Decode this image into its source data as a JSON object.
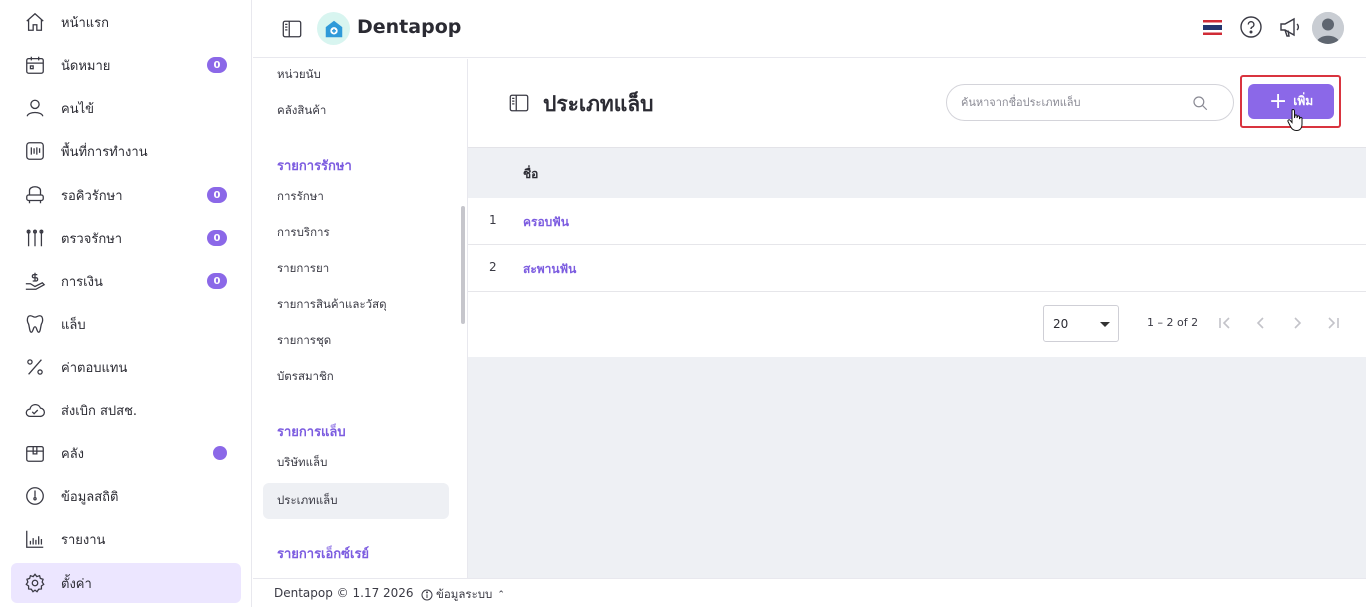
{
  "app": {
    "title": "Dentapop"
  },
  "sidebar": {
    "items": [
      {
        "label": "หน้าแรก",
        "icon": "home-icon"
      },
      {
        "label": "นัดหมาย",
        "icon": "calendar-icon",
        "badge": "0"
      },
      {
        "label": "คนไข้",
        "icon": "user-icon"
      },
      {
        "label": "พื้นที่การทำงาน",
        "icon": "workspace-icon"
      },
      {
        "label": "รอคิวรักษา",
        "icon": "dental-chair-icon",
        "badge": "0"
      },
      {
        "label": "ตรวจรักษา",
        "icon": "dental-tools-icon",
        "badge": "0"
      },
      {
        "label": "การเงิน",
        "icon": "money-hand-icon",
        "badge": "0"
      },
      {
        "label": "แล็บ",
        "icon": "tooth-icon"
      },
      {
        "label": "ค่าตอบแทน",
        "icon": "percent-icon"
      },
      {
        "label": "ส่งเบิก สปสช.",
        "icon": "cloud-check-icon"
      },
      {
        "label": "คลัง",
        "icon": "box-icon"
      },
      {
        "label": "ข้อมูลสถิติ",
        "icon": "clock-icon"
      },
      {
        "label": "รายงาน",
        "icon": "bar-chart-icon"
      },
      {
        "label": "ตั้งค่า",
        "icon": "gear-icon"
      }
    ],
    "active_index": 13,
    "accent_color": "#8b68e8"
  },
  "submenu": {
    "top_items": [
      "หน่วยนับ",
      "คลังสินค้า"
    ],
    "section_treatment": {
      "heading": "รายการรักษา",
      "items": [
        "การรักษา",
        "การบริการ",
        "รายการยา",
        "รายการสินค้าและวัสดุ",
        "รายการชุด",
        "บัตรสมาชิก"
      ]
    },
    "section_lab": {
      "heading": "รายการแล็บ",
      "items": [
        "บริษัทแล็บ",
        "ประเภทแล็บ"
      ]
    },
    "section_xray": {
      "heading": "รายการเอ็กซ์เรย์"
    }
  },
  "main": {
    "title": "ประเภทแล็บ",
    "search_placeholder": "ค้นหาจากชื่อประเภทแล็บ",
    "add_label": "เพิ่ม",
    "column_name": "ชื่อ",
    "rows": [
      {
        "num": "1",
        "name": "ครอบฟัน"
      },
      {
        "num": "2",
        "name": "สะพานฟัน"
      }
    ],
    "page_size": "20",
    "range": "1 – 2 of 2"
  },
  "footer": {
    "copyright": "Dentapop © 1.17 2026",
    "system_info": "ข้อมูลระบบ"
  }
}
